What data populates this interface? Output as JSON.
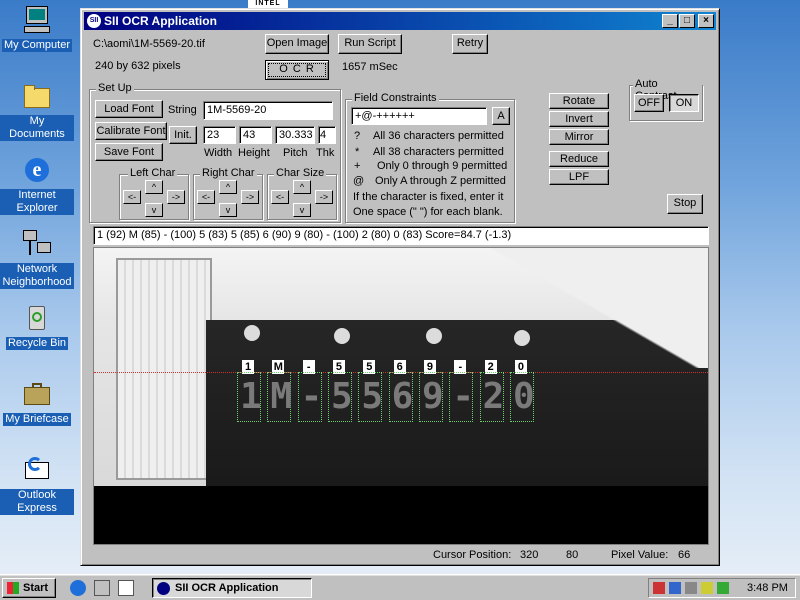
{
  "desktop": {
    "icons": [
      {
        "label": "My Computer",
        "icon": "computer-icon"
      },
      {
        "label": "My Documents",
        "icon": "folder-icon"
      },
      {
        "label": "Internet Explorer",
        "icon": "ie-icon"
      },
      {
        "label": "Network Neighborhood",
        "icon": "network-icon"
      },
      {
        "label": "Recycle Bin",
        "icon": "recycle-bin-icon"
      },
      {
        "label": "My Briefcase",
        "icon": "briefcase-icon"
      },
      {
        "label": "Outlook Express",
        "icon": "outlook-icon"
      }
    ],
    "intel_label": "INTEL"
  },
  "window": {
    "title": "SII OCR Application",
    "file_path": "C:\\aomi\\1M-5569-20.tif",
    "image_size": "240 by 632 pixels",
    "timing": "1657 mSec",
    "buttons": {
      "open_image": "Open Image",
      "run_script": "Run Script",
      "retry": "Retry",
      "ocr": "O C R",
      "load_font": "Load Font",
      "calibrate_font": "Calibrate Font",
      "save_font": "Save Font",
      "init": "Init.",
      "rotate": "Rotate",
      "invert": "Invert",
      "mirror": "Mirror",
      "reduce": "Reduce",
      "lpf": "LPF",
      "stop": "Stop",
      "off": "OFF",
      "on": "ON",
      "field_a": "A"
    },
    "setup": {
      "label": "Set Up",
      "string_label": "String",
      "string_value": "1M-5569-20",
      "width": "23",
      "height": "43",
      "pitch": "30.333",
      "thk": "4",
      "width_label": "Width",
      "height_label": "Height",
      "pitch_label": "Pitch",
      "thk_label": "Thk",
      "left_char": "Left Char",
      "right_char": "Right Char",
      "char_size": "Char Size",
      "arrows": {
        "left": "<-",
        "right": "->",
        "up": "^",
        "down": "v"
      }
    },
    "field_constraints": {
      "label": "Field Constraints",
      "value": "+@-++++++",
      "rules": [
        {
          "sym": "?",
          "text": "All 36 characters permitted"
        },
        {
          "sym": "*",
          "text": "All 38 characters permitted"
        },
        {
          "sym": "+",
          "text": "Only 0 through 9 permitted"
        },
        {
          "sym": "@",
          "text": "Only A through Z permitted"
        }
      ],
      "note1": "If the character is fixed, enter it",
      "note2": "One space (\" \") for each blank."
    },
    "auto_contrast": "Auto Contrast",
    "result": "1 (92) M (85) - (100) 5 (83) 5 (85) 6 (90) 9 (80) - (100) 2 (80) 0 (83)  Score=84.7   (-1.3)",
    "char_labels": [
      "1",
      "M",
      "-",
      "5",
      "5",
      "6",
      "9",
      "-",
      "2",
      "0"
    ],
    "status": {
      "cursor_label": "Cursor Position:",
      "cursor_x": "320",
      "cursor_y": "80",
      "pixel_label": "Pixel Value:",
      "pixel_value": "66"
    }
  },
  "taskbar": {
    "start": "Start",
    "task": "SII OCR Application",
    "clock": "3:48 PM"
  }
}
